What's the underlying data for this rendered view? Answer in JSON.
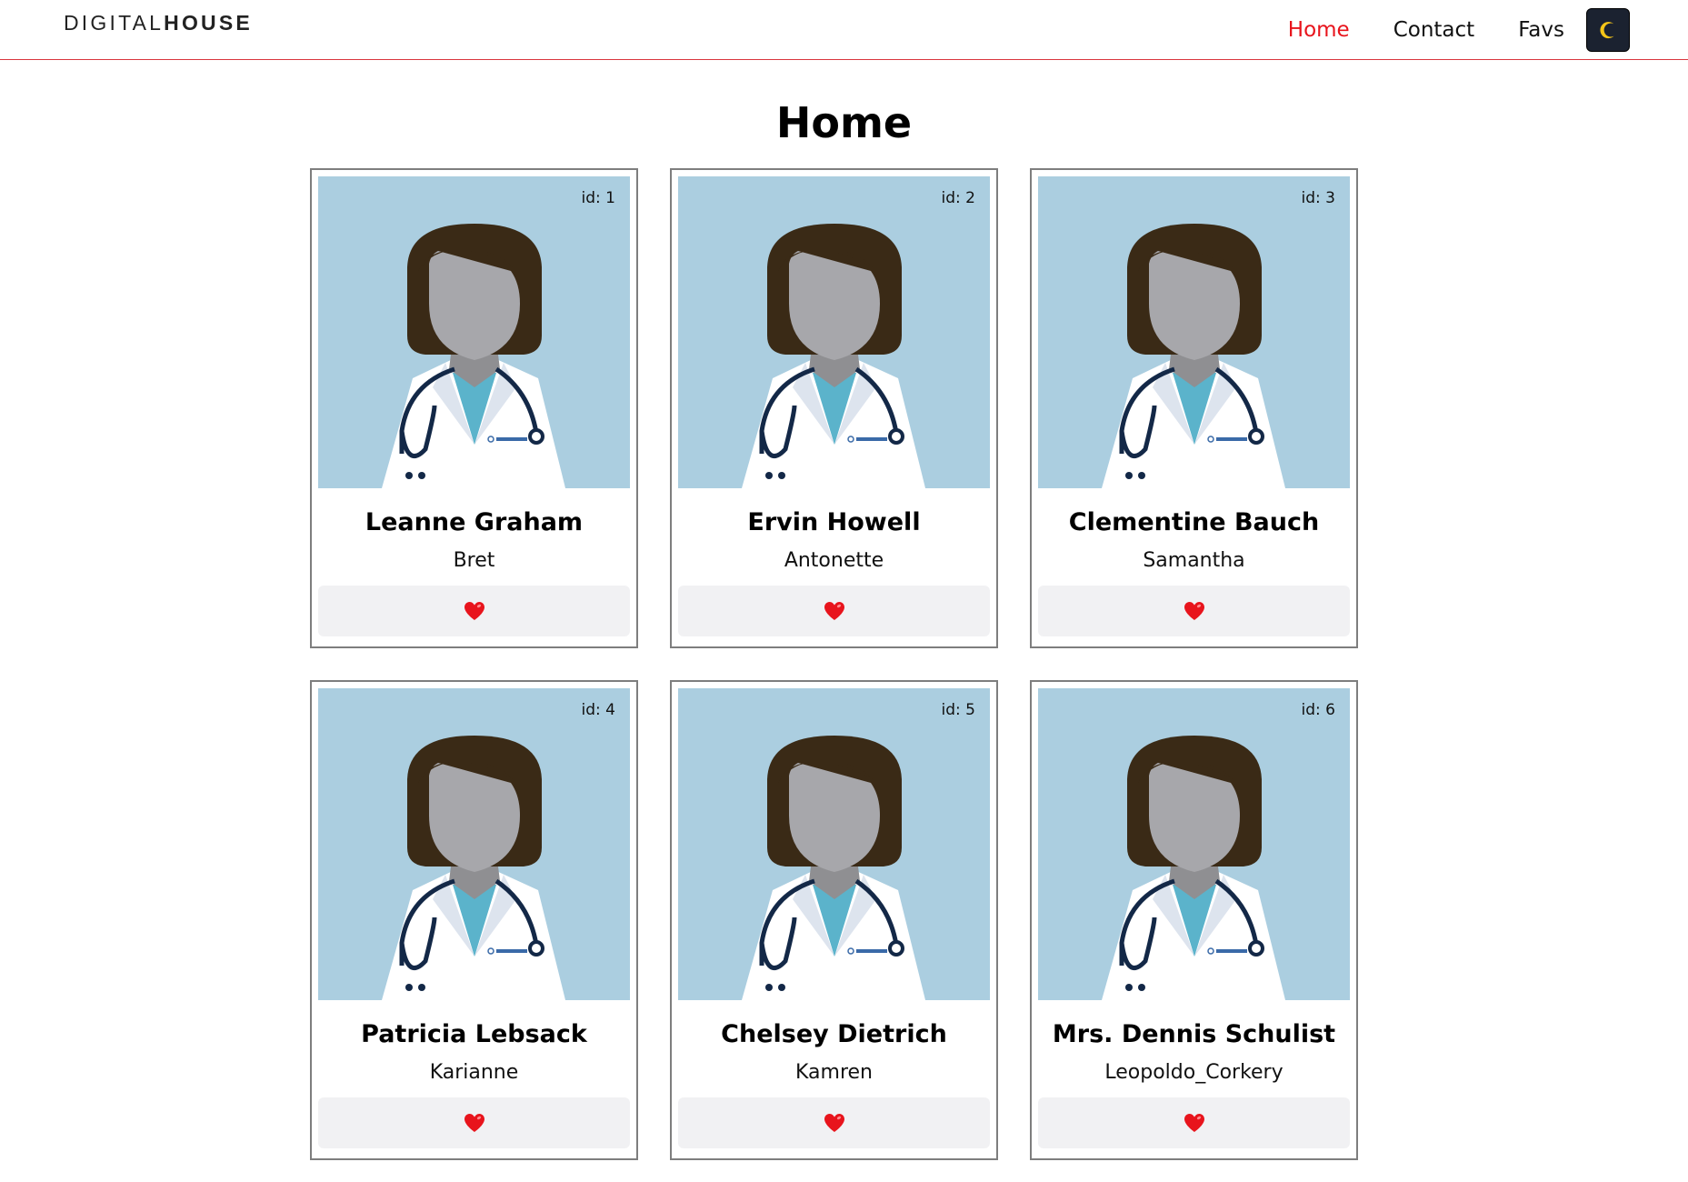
{
  "navbar": {
    "logo_thin": "DIGITAL",
    "logo_bold": "HOUSE",
    "links": [
      "Home",
      "Contact",
      "Favs"
    ],
    "active": "Home",
    "theme_toggle_icon": "moon-icon"
  },
  "page": {
    "title": "Home"
  },
  "cards": [
    {
      "id_label": "id: 1",
      "name": "Leanne Graham",
      "username": "Bret"
    },
    {
      "id_label": "id: 2",
      "name": "Ervin Howell",
      "username": "Antonette"
    },
    {
      "id_label": "id: 3",
      "name": "Clementine Bauch",
      "username": "Samantha"
    },
    {
      "id_label": "id: 4",
      "name": "Patricia Lebsack",
      "username": "Karianne"
    },
    {
      "id_label": "id: 5",
      "name": "Chelsey Dietrich",
      "username": "Kamren"
    },
    {
      "id_label": "id: 6",
      "name": "Mrs. Dennis Schulist",
      "username": "Leopoldo_Corkery"
    }
  ],
  "colors": {
    "accent": "#e8141c",
    "navbar_border": "#d9363e",
    "card_image_bg": "#abcee0",
    "fav_button_bg": "#f1f1f3",
    "heart": "#e8141c"
  }
}
